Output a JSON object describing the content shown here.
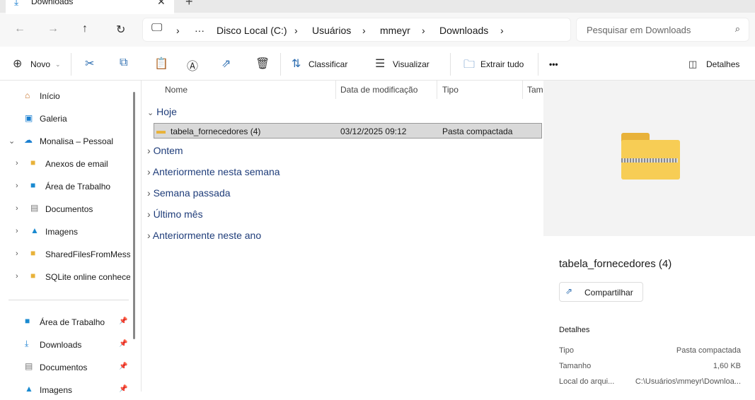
{
  "tab": {
    "title": "Downloads",
    "close": "✕",
    "new": "+"
  },
  "breadcrumb": [
    "Disco Local (C:)",
    "Usuários",
    "mmeyr",
    "Downloads"
  ],
  "search": {
    "placeholder": "Pesquisar em Downloads"
  },
  "toolbar": {
    "new": "Novo",
    "sort": "Classificar",
    "view": "Visualizar",
    "extract": "Extrair tudo",
    "more": "•••",
    "details": "Detalhes"
  },
  "sidebar": {
    "items": [
      {
        "label": "Início",
        "icon": "home-icon"
      },
      {
        "label": "Galeria",
        "icon": "gallery-icon"
      },
      {
        "label": "Monalisa – Pessoal",
        "icon": "cloud-icon"
      },
      {
        "label": "Anexos de email",
        "icon": "folder-icon"
      },
      {
        "label": "Área de Trabalho",
        "icon": "desktop-icon"
      },
      {
        "label": "Documentos",
        "icon": "documents-icon"
      },
      {
        "label": "Imagens",
        "icon": "pictures-icon"
      },
      {
        "label": "SharedFilesFromMesse",
        "icon": "folder-icon"
      },
      {
        "label": "SQLite online conhece",
        "icon": "folder-icon"
      }
    ],
    "pinned": [
      {
        "label": "Área de Trabalho",
        "icon": "desktop-icon"
      },
      {
        "label": "Downloads",
        "icon": "download-icon"
      },
      {
        "label": "Documentos",
        "icon": "documents-icon"
      },
      {
        "label": "Imagens",
        "icon": "pictures-icon"
      }
    ]
  },
  "columns": [
    "Nome",
    "Data de modificação",
    "Tipo",
    "Tam"
  ],
  "groups": [
    "Hoje",
    "Ontem",
    "Anteriormente nesta semana",
    "Semana passada",
    "Último mês",
    "Anteriormente neste ano"
  ],
  "file": {
    "name": "tabela_fornecedores (4)",
    "date": "03/12/2025 09:12",
    "type": "Pasta compactada"
  },
  "details": {
    "title": "tabela_fornecedores (4)",
    "share": "Compartilhar",
    "section": "Detalhes",
    "rows": [
      {
        "k": "Tipo",
        "v": "Pasta compactada"
      },
      {
        "k": "Tamanho",
        "v": "1,60 KB"
      },
      {
        "k": "Local do arqui...",
        "v": "C:\\Usuários\\mmeyr\\Downloa..."
      }
    ]
  }
}
